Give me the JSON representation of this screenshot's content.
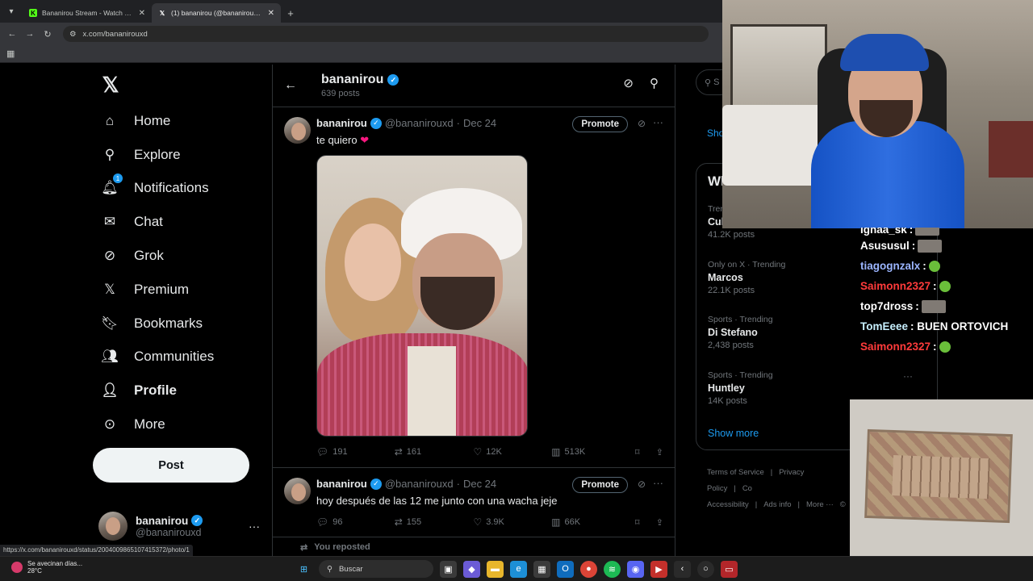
{
  "browser": {
    "tabs": [
      {
        "title": "Bananirou Stream - Watch Live",
        "favicon": "K",
        "favicon_color": "#53fc18",
        "active": false
      },
      {
        "title": "(1) bananirou (@bananirouxd) / X",
        "favicon": "X",
        "favicon_color": "#ffffff",
        "active": true
      }
    ],
    "url": "x.com/bananirouxd",
    "status_url": "https://x.com/bananirouxd/status/2004009865107415372/photo/1"
  },
  "nav": {
    "items": [
      {
        "label": "Home",
        "icon": "home-icon",
        "glyph": "⌂"
      },
      {
        "label": "Explore",
        "icon": "search-icon",
        "glyph": "⚲"
      },
      {
        "label": "Notifications",
        "icon": "bell-icon",
        "glyph": "🔔︎",
        "badge": "1"
      },
      {
        "label": "Chat",
        "icon": "mail-icon",
        "glyph": "✉"
      },
      {
        "label": "Grok",
        "icon": "grok-icon",
        "glyph": "⊘"
      },
      {
        "label": "Premium",
        "icon": "x-premium-icon",
        "glyph": "𝕏"
      },
      {
        "label": "Bookmarks",
        "icon": "bookmark-icon",
        "glyph": "🔖︎"
      },
      {
        "label": "Communities",
        "icon": "communities-icon",
        "glyph": "👥︎"
      },
      {
        "label": "Profile",
        "icon": "profile-icon",
        "glyph": "👤︎",
        "bold": true
      },
      {
        "label": "More",
        "icon": "more-circle-icon",
        "glyph": "⊙"
      }
    ],
    "post_label": "Post"
  },
  "account": {
    "name": "bananirou",
    "handle": "@bananirouxd"
  },
  "profile_header": {
    "name": "bananirou",
    "post_count": "639 posts"
  },
  "tweets": [
    {
      "name": "bananirou",
      "handle": "@bananirouxd",
      "date": "Dec 24",
      "text": "te quiero",
      "emoji": "❤",
      "promote": "Promote",
      "replies": "191",
      "reposts": "161",
      "likes": "12K",
      "views": "513K"
    },
    {
      "name": "bananirou",
      "handle": "@bananirouxd",
      "date": "Dec 24",
      "text": "hoy después de las 12 me junto con una wacha jeje",
      "promote": "Promote",
      "replies": "96",
      "reposts": "155",
      "likes": "3.9K",
      "views": "66K"
    }
  ],
  "reposted_label": "You reposted",
  "right": {
    "search_placeholder": "S",
    "show_fragment": "Sho",
    "trends_title": "Wh",
    "trends": [
      {
        "context": "Trend",
        "name": "Cul",
        "posts": "41.2K posts"
      },
      {
        "context": "Only on X · Trending",
        "name": "Marcos",
        "posts": "22.1K posts"
      },
      {
        "context": "Sports · Trending",
        "name": "Di Stefano",
        "posts": "2,438 posts"
      },
      {
        "context": "Sports · Trending",
        "name": "Huntley",
        "posts": "14K posts"
      }
    ],
    "show_more": "Show more",
    "footer": [
      "Terms of Service",
      "|",
      "Privacy Policy",
      "|",
      "Co",
      "Accessibility",
      "|",
      "Ads info",
      "|",
      "More ···",
      "©"
    ]
  },
  "chat": [
    {
      "user": "Ignaa_sk",
      "color": "#ffffff",
      "msg": ":",
      "emote": "grey"
    },
    {
      "user": "Asususul",
      "color": "#ffffff",
      "msg": ":",
      "emote": "grey"
    },
    {
      "user": "tiagognzalx",
      "color": "#9bb5ff",
      "msg": ":",
      "emote": "green"
    },
    {
      "user": "Saimonn2327",
      "color": "#ff3b3b",
      "msg": ":",
      "emote": "green"
    },
    {
      "user": "top7dross",
      "color": "#ffffff",
      "msg": ":",
      "emote": "grey"
    },
    {
      "user": "TomEeee",
      "color": "#c8f0ff",
      "msg": ": BUEN ORTOVICH",
      "emote": ""
    },
    {
      "user": "Saimonn2327",
      "color": "#ff3b3b",
      "msg": ":",
      "emote": "green"
    }
  ],
  "taskbar": {
    "weather_text": "Se avecinan días...",
    "temp": "28°C",
    "search_label": "Buscar"
  }
}
